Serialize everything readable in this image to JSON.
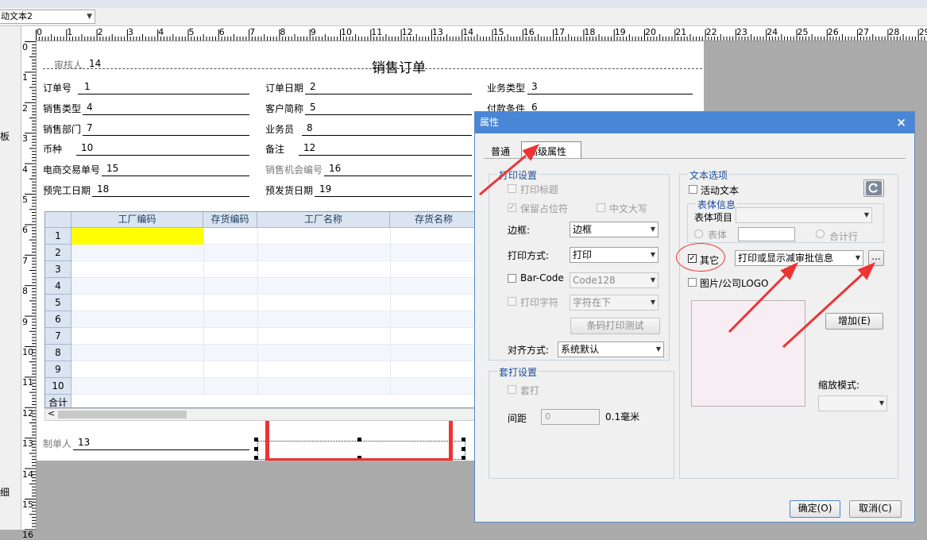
{
  "field_combo": {
    "value": "动文本2"
  },
  "side_labels": [
    "板",
    "细"
  ],
  "ruler": {
    "h_numbers": [
      "0",
      "1",
      "2",
      "3",
      "4",
      "5",
      "6",
      "7",
      "8",
      "9",
      "10",
      "11",
      "12",
      "13",
      "14",
      "15",
      "16",
      "17",
      "18",
      "19",
      "20",
      "21",
      "22",
      "23",
      "24",
      "25",
      "26",
      "27",
      "28",
      "29"
    ],
    "v_numbers": [
      "0",
      "1",
      "2",
      "3",
      "4",
      "5",
      "6",
      "7",
      "8",
      "9",
      "10",
      "11",
      "12",
      "13",
      "14",
      "15",
      "16"
    ]
  },
  "report": {
    "title": "销售订单",
    "reviewer": {
      "label": "审核人",
      "value": "14"
    },
    "fields": [
      {
        "label": "订单号",
        "value": "1"
      },
      {
        "label": "订单日期",
        "value": "2"
      },
      {
        "label": "业务类型",
        "value": "3"
      },
      {
        "label": "销售类型",
        "value": "4"
      },
      {
        "label": "客户简称",
        "value": "5"
      },
      {
        "label": "付款条件",
        "value": "6"
      },
      {
        "label": "销售部门",
        "value": "7"
      },
      {
        "label": "业务员",
        "value": "8"
      },
      {
        "label": "币种",
        "value": "10"
      },
      {
        "label": "备注",
        "value": "12"
      },
      {
        "label": "电商交易单号",
        "value": "15"
      },
      {
        "label": "销售机会编号",
        "value": "16"
      },
      {
        "label": "预完工日期",
        "value": "18"
      },
      {
        "label": "预发货日期",
        "value": "19"
      }
    ],
    "maker": {
      "label": "制单人",
      "value": "13"
    }
  },
  "grid": {
    "columns": [
      "工厂编码",
      "存货编码",
      "工厂名称",
      "存货名称"
    ],
    "rows": [
      "1",
      "2",
      "3",
      "4",
      "5",
      "6",
      "7",
      "8",
      "9",
      "10"
    ],
    "total_label": "合计"
  },
  "dialog": {
    "title": "属性",
    "close": "×",
    "tabs": [
      "普通",
      "高级属性"
    ],
    "print_group": {
      "title": "打印设置",
      "print_title": "打印标题",
      "keep_placeholder": "保留占位符",
      "chinese_upper": "中文大写",
      "border_label": "边框:",
      "border_value": "边框",
      "print_mode_label": "打印方式:",
      "print_mode_value": "打印",
      "barcode_label": "Bar-Code",
      "barcode_value": "Code128",
      "print_chars_label": "打印字符",
      "print_chars_value": "字符在下",
      "barcode_test_button": "条码打印测试",
      "align_label": "对齐方式:",
      "align_value": "系统默认"
    },
    "overprint_group": {
      "title": "套打设置",
      "overprint": "套打",
      "spacing_label": "间距",
      "spacing_value": "0",
      "spacing_unit": "0.1毫米"
    },
    "text_group": {
      "title": "文本选项",
      "active_text": "活动文本",
      "body_info_title": "表体信息",
      "body_item_label": "表体项目",
      "body_radio": "表体",
      "total_row_radio": "合计行",
      "other_label": "其它",
      "other_value": "打印或显示减审批信息",
      "more_button": "...",
      "logo_label": "图片/公司LOGO",
      "add_button": "增加(E)",
      "zoom_label": "缩放模式:"
    },
    "ok_button": "确定(O)",
    "cancel_button": "取消(C)"
  },
  "colors": {
    "title_bar": "#4a86d6",
    "annotation_red": "#ee3333",
    "grid_header": "#dbe5f1",
    "highlight": "#ffff00"
  }
}
